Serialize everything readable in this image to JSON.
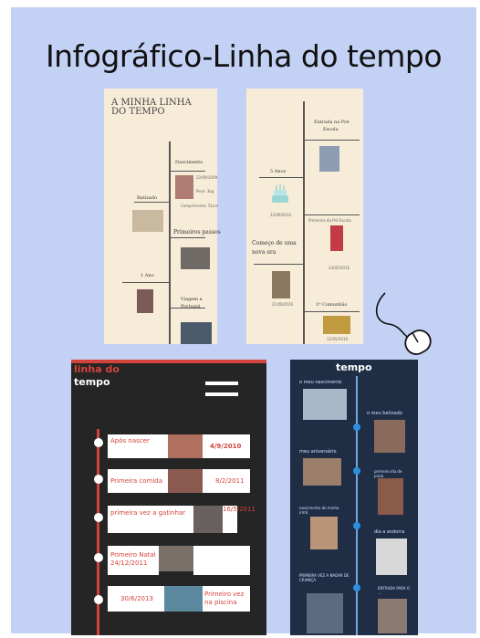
{
  "title": "Infográfico-Linha do tempo",
  "card1": {
    "heading_line1": "A MINHA LINHA",
    "heading_line2": "DO TEMPO",
    "events": {
      "nascimento": "Nascimento",
      "nascimento_detail1": "22/09/2009",
      "nascimento_detail2": "Peso: 3kg",
      "nascimento_detail3": "Comprimento: 51cm",
      "batizado": "Batizado",
      "batizado_date": "2010",
      "primeiros_passos": "Primeiros passos",
      "primeiros_passos_date": "2010",
      "um_ano": "1 Ano",
      "um_ano_date": "22/09/2010",
      "viagem": "Viagem a Portugal",
      "viagem_line1": "Viagem a",
      "viagem_line2": "Portugal"
    }
  },
  "card2": {
    "entrada": "Entrada na Pré Escola",
    "entrada_line1": "Entrada na Pré",
    "entrada_line2": "Escola",
    "entrada_date": "10/10/2009",
    "cinco_anos": "5 Anos",
    "cinco_anos_date": "22/09/2014",
    "primeiros_pre": "Primeiros da Pré Escola",
    "comeco_line1": "Começo de uma",
    "comeco_line2": "nova era",
    "comeco_date": "21/09/2016",
    "date_b": "24/05/2016",
    "comunhao": "1ª Comunhão",
    "comunhao_date": "12/05/2019"
  },
  "card3": {
    "heading_line1": "linha do",
    "heading_line2": "tempo",
    "items": [
      {
        "left": "Após nascer",
        "right": "4/9/2010"
      },
      {
        "left": "Primeira comida",
        "right": "8/2/2011"
      },
      {
        "left": "primeira vez a gatinhar",
        "right": "16/5/2011"
      },
      {
        "left": "Primeiro Natal 24/12/2011",
        "right": ""
      },
      {
        "left": "30/6/2013",
        "right": "Primeiro vez na piscina"
      }
    ]
  },
  "card4": {
    "heading": "tempo",
    "labels": {
      "l1": "o meu nascimento",
      "l2": "o meu batizado",
      "l3": "meu aniversário",
      "l4": "primeiro dia de praia",
      "l5": "nascimento do minha irmã",
      "l6": "dia a andorra",
      "l7": "PRIMEIRA VEZ A NADAR DE CRIANÇA",
      "l8": "ENTRADA PARA O ..."
    }
  },
  "colors": {
    "background": "#c3d2f4",
    "card1_bg": "#f7ecd8",
    "card2_bg": "#f7ecd8",
    "card3_bg": "#252525",
    "card3_accent": "#d4433b",
    "card4_bg": "#1f2e45",
    "card4_accent": "#2d8fe0"
  },
  "icons": {
    "cake": "birthday-cake-icon",
    "mouse": "computer-mouse-icon",
    "menu": "hamburger-menu-icon"
  }
}
